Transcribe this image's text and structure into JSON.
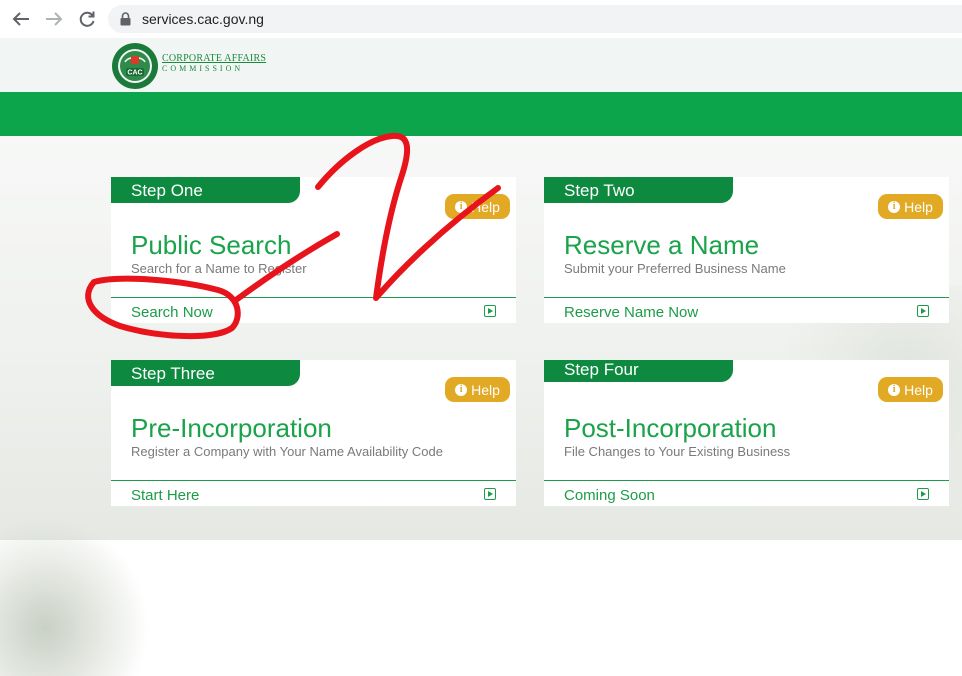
{
  "browser": {
    "url": "services.cac.gov.ng",
    "back_icon": "back-arrow-icon",
    "forward_icon": "forward-arrow-icon",
    "reload_icon": "reload-icon",
    "lock_icon": "lock-icon"
  },
  "header": {
    "seal_text": "CAC",
    "logo_line1": "CORPORATE AFFAIRS",
    "logo_line2": "COMMISSION",
    "brand_green": "#0ca54c"
  },
  "cards": [
    {
      "step": "Step One",
      "title": "Public Search",
      "subtitle": "Search for a Name to Register",
      "link": "Search Now",
      "help": "Help"
    },
    {
      "step": "Step Two",
      "title": "Reserve a Name",
      "subtitle": "Submit your Preferred Business Name",
      "link": "Reserve Name Now",
      "help": "Help"
    },
    {
      "step": "Step Three",
      "title": "Pre-Incorporation",
      "subtitle": "Register a Company with Your Name Availability Code",
      "link": "Start Here",
      "help": "Help"
    },
    {
      "step": "Step Four",
      "title": "Post-Incorporation",
      "subtitle": "File Changes to Your Existing Business",
      "link": "Coming Soon",
      "help": "Help"
    }
  ],
  "colors": {
    "step_green": "#0d8a3f",
    "title_green": "#1aa34a",
    "help_gold": "#e2a925",
    "annotation_red": "#e8141c"
  }
}
